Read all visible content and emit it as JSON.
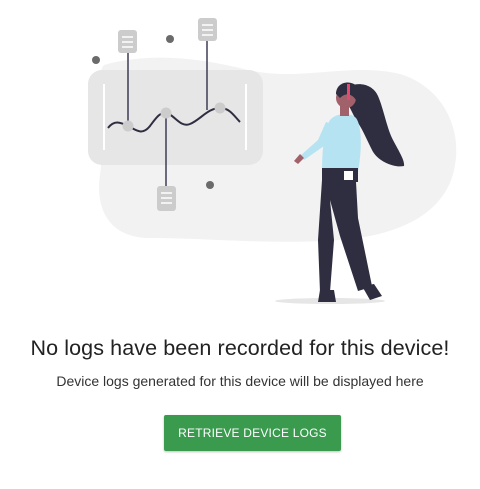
{
  "empty_state": {
    "title": "No logs have been recorded for this device!",
    "subtitle": "Device logs generated for this device will be displayed here",
    "button_label": "RETRIEVE DEVICE LOGS"
  },
  "colors": {
    "button": "#3a9b4f",
    "blob": "#f2f2f2",
    "panel": "#e6e6e6",
    "node": "#cccccc",
    "dark": "#2f2e41",
    "shirt": "#b6e3f2",
    "skin": "#a0616a"
  },
  "icons": [
    "server-icon",
    "line-chart-icon",
    "person-illustration"
  ]
}
